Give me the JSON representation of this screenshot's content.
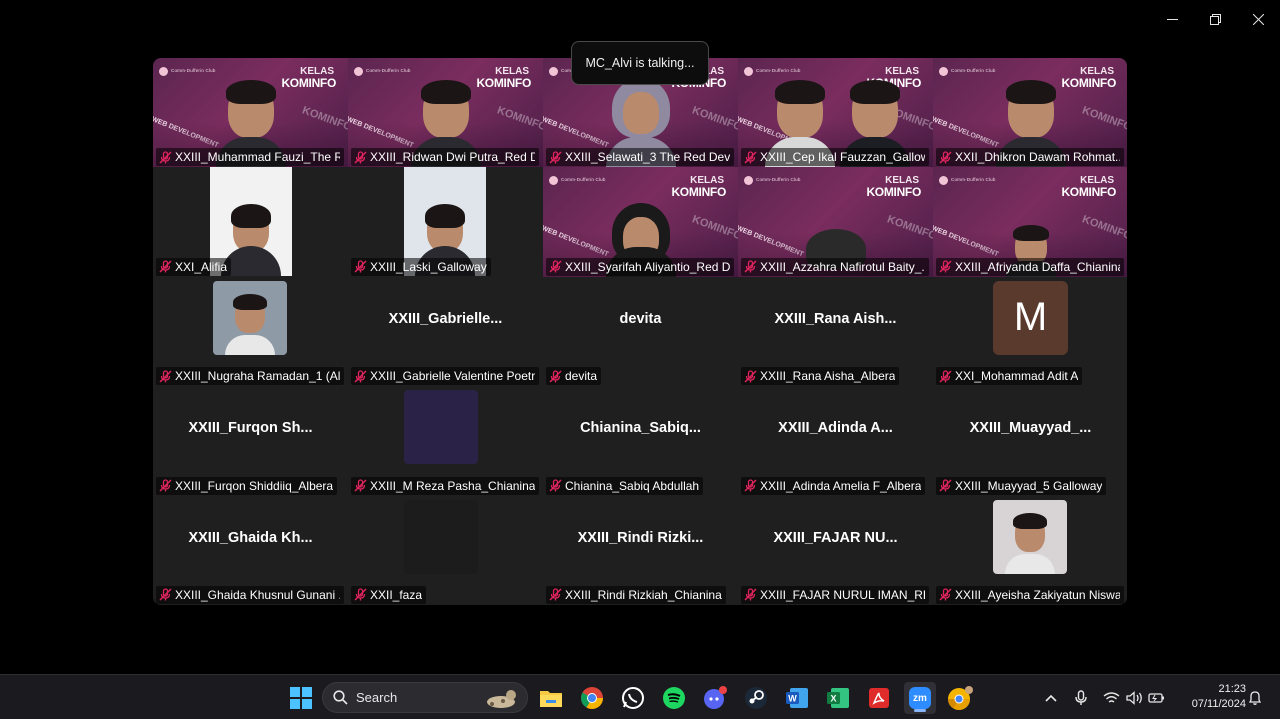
{
  "window": {
    "minimize_icon": "minimize-icon",
    "restore_icon": "restore-icon",
    "close_icon": "close-icon"
  },
  "talking_indicator": "MC_Alvi is talking...",
  "banner": {
    "logo_text": "Comm-Dufferin Club",
    "kelas": "KELAS",
    "kominfo": "KOMINFO",
    "web_development": "WEB DEVELOPMENT",
    "wave_text": "KOMINFO"
  },
  "participants": [
    {
      "name": "XXIII_Muhammad Fauzi_The R...",
      "display": ""
    },
    {
      "name": "XXIII_Ridwan Dwi Putra_Red D...",
      "display": ""
    },
    {
      "name": "XXIII_Selawati_3 The Red Devon",
      "display": ""
    },
    {
      "name": "XXIII_Cep Ikal Fauzzan_Galloway",
      "display": ""
    },
    {
      "name": "XXII_Dhikron Dawam Rohmat...",
      "display": ""
    },
    {
      "name": "XXI_Alifia",
      "display": ""
    },
    {
      "name": "XXIII_Laski_Galloway",
      "display": ""
    },
    {
      "name": "XXIII_Syarifah Aliyantio_Red D...",
      "display": ""
    },
    {
      "name": "XXIII_Azzahra Nafirotul Baity_...",
      "display": ""
    },
    {
      "name": "XXIII_Afriyanda Daffa_Chianina",
      "display": ""
    },
    {
      "name": "XXIII_Nugraha Ramadan_1 (Al...",
      "display": ""
    },
    {
      "name": "XXIII_Gabrielle Valentine Poetr...",
      "display": "XXIII_Gabrielle..."
    },
    {
      "name": "devita",
      "display": "devita"
    },
    {
      "name": "XXIII_Rana Aisha_Albera",
      "display": "XXIII_Rana Aish..."
    },
    {
      "name": "XXI_Mohammad Adit A",
      "display": "",
      "initial": "M"
    },
    {
      "name": "XXIII_Furqon Shiddiiq_Albera",
      "display": "XXIII_Furqon Sh..."
    },
    {
      "name": "XXIII_M Reza Pasha_Chianina",
      "display": ""
    },
    {
      "name": "Chianina_Sabiq Abdullah",
      "display": "Chianina_Sabiq..."
    },
    {
      "name": "XXIII_Adinda Amelia F_Albera",
      "display": "XXIII_Adinda A..."
    },
    {
      "name": "XXIII_Muayyad_5 Galloway",
      "display": "XXIII_Muayyad_..."
    },
    {
      "name": "XXIII_Ghaida Khusnul Gunani ...",
      "display": "XXIII_Ghaida Kh..."
    },
    {
      "name": "XXII_faza",
      "display": ""
    },
    {
      "name": "XXIII_Rindi Rizkiah_Chianina",
      "display": "XXIII_Rindi Rizki..."
    },
    {
      "name": "XXIII_FAJAR NURUL IMAN_RE...",
      "display": "XXIII_FAJAR NU..."
    },
    {
      "name": "XXIII_Ayeisha Zakiyatun Niswa...",
      "display": ""
    }
  ],
  "taskbar": {
    "search_label": "Search",
    "apps": [
      "start-icon",
      "file-explorer-icon",
      "chrome-icon",
      "whatsapp-icon",
      "spotify-icon",
      "discord-icon",
      "steam-icon",
      "word-icon",
      "excel-icon",
      "acrobat-icon",
      "zoom-icon",
      "chrome-canary-icon"
    ],
    "zoom_label": "zm",
    "time": "21:23",
    "date": "07/11/2024"
  },
  "colors": {
    "accent": "#8ab4f8",
    "muted_mic": "#e0245e",
    "banner": "#6d2a58",
    "tile_bg": "#1f1f1f"
  }
}
